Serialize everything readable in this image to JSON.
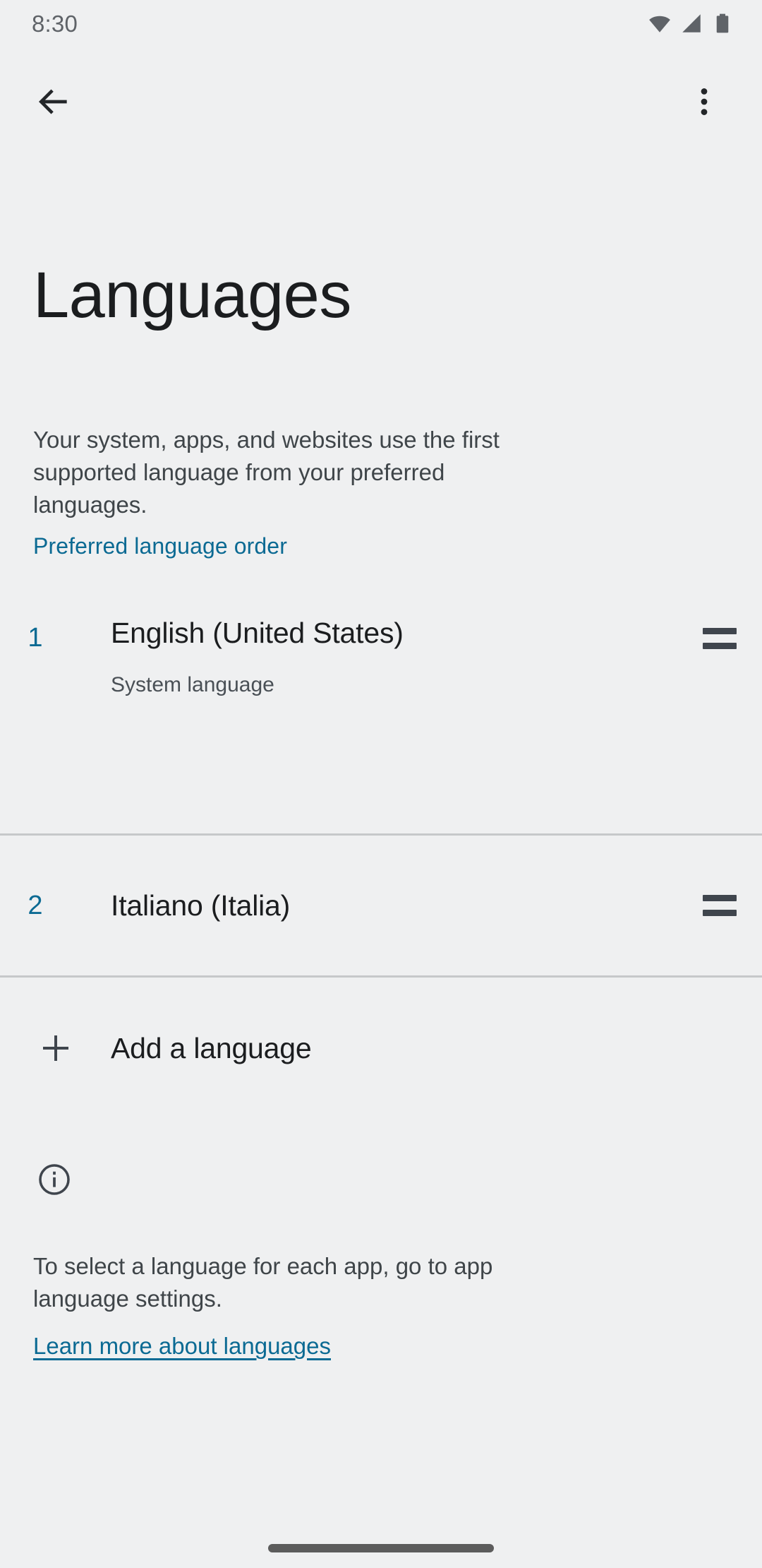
{
  "status_bar": {
    "time": "8:30",
    "icons": [
      "wifi-icon",
      "cellular-signal-icon",
      "battery-icon"
    ]
  },
  "action_bar": {
    "back_icon": "back-arrow-icon",
    "overflow_icon": "more-options-icon"
  },
  "page": {
    "title": "Languages",
    "description": "Your system, apps, and websites use the first supported language from your preferred languages."
  },
  "section": {
    "header": "Preferred language order"
  },
  "languages": [
    {
      "index": "1",
      "name": "English (United States)",
      "subtitle": "System language",
      "handle_icon": "drag-handle-icon"
    },
    {
      "index": "2",
      "name": "Italiano (Italia)",
      "subtitle": "",
      "handle_icon": "drag-handle-icon"
    }
  ],
  "add_language": {
    "label": "Add a language",
    "icon": "plus-icon"
  },
  "footer": {
    "icon": "info-circle-icon",
    "text": "To select a language for each app, go to app language settings.",
    "link": "Learn more about languages"
  },
  "colors": {
    "background": "#eff0f1",
    "accent": "#0b6a93",
    "primary_text": "#1b1d1f",
    "secondary_text": "#3f4549",
    "divider": "#c6c8ca",
    "icon": "#3f454d"
  }
}
